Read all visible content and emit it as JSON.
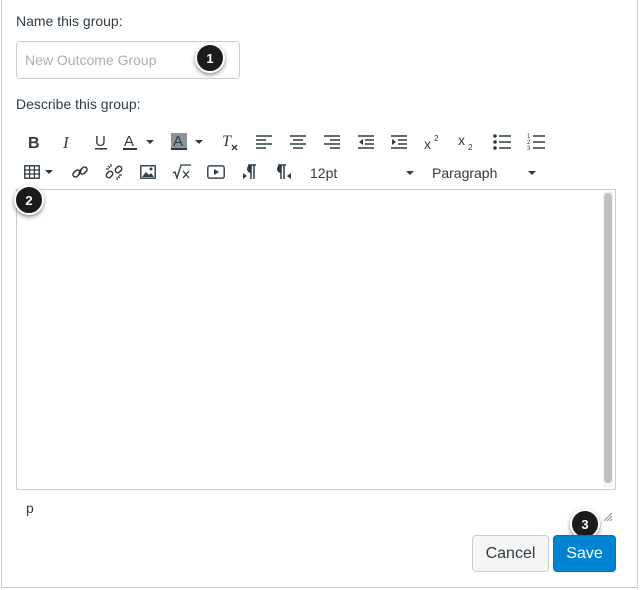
{
  "form": {
    "name_label": "Name this group:",
    "name_placeholder": "New Outcome Group",
    "name_value": "",
    "describe_label": "Describe this group:"
  },
  "toolbar": {
    "row1": [
      "bold-icon",
      "italic-icon",
      "underline-icon",
      "text-color-icon",
      "background-color-icon",
      "clear-formatting-icon",
      "align-left-icon",
      "align-center-icon",
      "align-right-icon",
      "outdent-icon",
      "indent-icon",
      "superscript-icon",
      "subscript-icon",
      "bullet-list-icon",
      "numbered-list-icon"
    ],
    "row2": [
      "table-icon",
      "link-icon",
      "unlink-icon",
      "image-icon",
      "equation-icon",
      "media-icon",
      "ltr-icon",
      "rtl-icon"
    ],
    "font_size": "12pt",
    "block_format": "Paragraph"
  },
  "editor": {
    "content": "",
    "status_path": "p"
  },
  "badges": {
    "b1": "1",
    "b2": "2",
    "b3": "3"
  },
  "buttons": {
    "cancel": "Cancel",
    "save": "Save"
  },
  "colors": {
    "primary": "#0084d1",
    "badge": "#1b1b1b",
    "border": "#c7cdd1",
    "text": "#2d3b45"
  }
}
